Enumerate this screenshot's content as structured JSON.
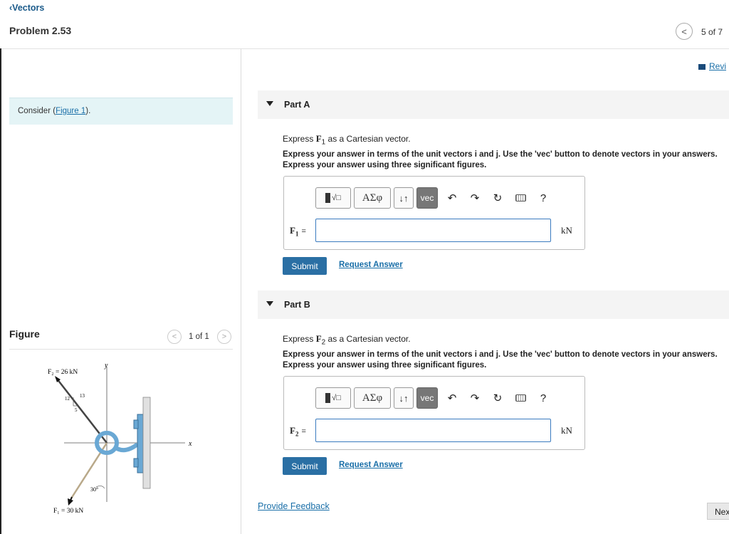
{
  "header": {
    "back_label": "Vectors",
    "problem_title": "Problem 2.53",
    "page_counter": "5 of 7"
  },
  "left": {
    "consider_prefix": "Consider (",
    "figure_link": "Figure 1",
    "consider_suffix": ").",
    "figure_heading": "Figure",
    "figure_counter": "1 of 1",
    "figure": {
      "f2_label": "F₂ = 26 kN",
      "f1_label": "F₁ = 30 kN",
      "y_axis": "y",
      "x_axis": "x",
      "ratio_12": "12",
      "ratio_13": "13",
      "ratio_5": "5",
      "angle": "30°"
    }
  },
  "review_label": "Revi",
  "parts": [
    {
      "label": "Part A",
      "express_prefix": "Express ",
      "vector_symbol": "F",
      "vector_sub": "1",
      "express_suffix": " as a Cartesian vector.",
      "instr_line1": "Express your answer in terms of the unit vectors i and j. Use the 'vec' button to denote vectors in your answers.",
      "instr_line2": "Express your answer using three significant figures.",
      "field_label": "F",
      "field_sub": "1",
      "unit": "kN",
      "submit": "Submit",
      "request": "Request Answer"
    },
    {
      "label": "Part B",
      "express_prefix": "Express ",
      "vector_symbol": "F",
      "vector_sub": "2",
      "express_suffix": " as a Cartesian vector.",
      "instr_line1": "Express your answer in terms of the unit vectors i and j. Use the 'vec' button to denote vectors in your answers.",
      "instr_line2": "Express your answer using three significant figures.",
      "field_label": "F",
      "field_sub": "2",
      "unit": "kN",
      "submit": "Submit",
      "request": "Request Answer"
    }
  ],
  "toolbar": {
    "symbols": "ΑΣφ",
    "updown": "↓↑",
    "vec": "vec",
    "help": "?",
    "undo": "↶",
    "redo": "↷",
    "reset": "↻"
  },
  "footer": {
    "feedback": "Provide Feedback",
    "next": "Nex"
  }
}
